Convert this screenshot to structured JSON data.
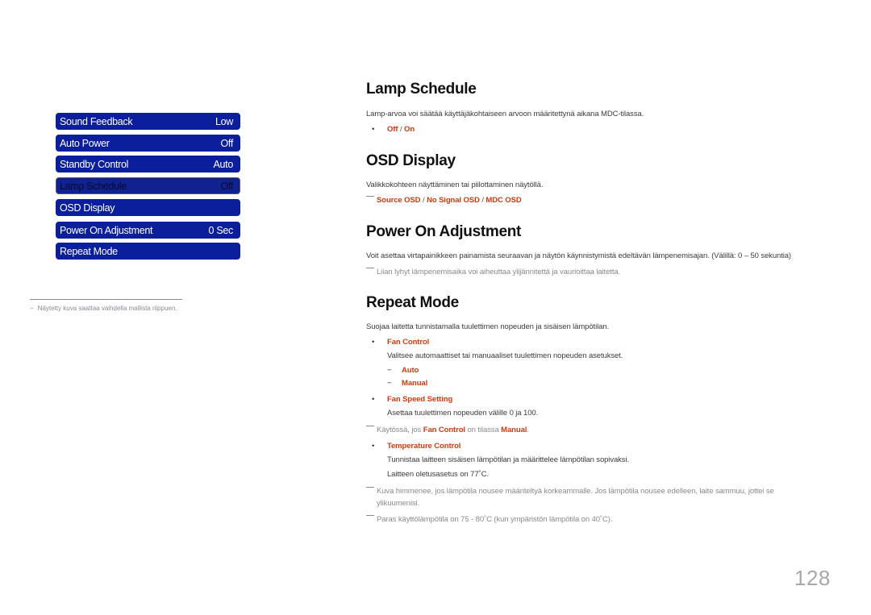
{
  "osd_menu": {
    "items": [
      {
        "label": "Sound Feedback",
        "value": "Low",
        "selected": false
      },
      {
        "label": "Auto Power",
        "value": "Off",
        "selected": false
      },
      {
        "label": "Standby Control",
        "value": "Auto",
        "selected": false
      },
      {
        "label": "Lamp Schedule",
        "value": "Off",
        "selected": true
      },
      {
        "label": "OSD Display",
        "value": "",
        "selected": false
      },
      {
        "label": "Power On Adjustment",
        "value": "0 Sec",
        "selected": false
      },
      {
        "label": "Repeat Mode",
        "value": "",
        "selected": false
      }
    ]
  },
  "footnote": {
    "dash": "−",
    "text": "Näytetty kuva saattaa vaihdella mallista riippuen."
  },
  "sections": {
    "lamp_schedule": {
      "title": "Lamp Schedule",
      "desc": "Lamp-arvoa voi säätää käyttäjäkohtaiseen arvoon määritettynä aikana MDC-tilassa.",
      "bullet": "•",
      "opt1": "Off",
      "slash": " / ",
      "opt2": "On"
    },
    "osd_display": {
      "title": "OSD Display",
      "desc": "Valikkokohteen näyttäminen tai piilottaminen näytöllä.",
      "opt1": "Source OSD",
      "opt2": "No Signal OSD",
      "opt3": "MDC OSD",
      "slash": " / "
    },
    "power_on_adjustment": {
      "title": "Power On Adjustment",
      "desc": "Voit asettaa virtapainikkeen painamista seuraavan ja näytön käynnistymistä edeltävän lämpenemisajan. (Välillä: 0 – 50 sekuntia)",
      "note": "Liian lyhyt lämpenemisaika voi aiheuttaa ylijännitettä ja vaurioittaa laitetta."
    },
    "repeat_mode": {
      "title": "Repeat Mode",
      "desc": "Suojaa laitetta tunnistamalla tuulettimen nopeuden ja sisäisen lämpötilan.",
      "bullet": "•",
      "sub_dash": "−",
      "fan_control": {
        "label": "Fan Control",
        "desc": "Valitsee automaattiset tai manuaaliset tuulettimen nopeuden asetukset.",
        "options": [
          "Auto",
          "Manual"
        ]
      },
      "fan_speed": {
        "label": "Fan Speed Setting",
        "desc": "Asettaa tuulettimen nopeuden välille 0 ja 100."
      },
      "fan_note": {
        "pre": "Käytössä, jos ",
        "term1": "Fan Control",
        "mid": " on tilassa ",
        "term2": "Manual",
        "post": "."
      },
      "temperature": {
        "label": "Temperature Control",
        "desc": "Tunnistaa laitteen sisäisen lämpötilan ja määrittelee lämpötilan sopivaksi.",
        "default": "Laitteen oletusasetus on 77˚C."
      },
      "note1a": "Kuva himmenee, jos lämpötila nousee määriteltyä korkeammalle. Jos lämpötila nousee edelleen, laite sammuu, jottei se",
      "note1b": "ylikuumenisi.",
      "note2": "Paras käyttölämpötila on 75 - 80˚C (kun ympäristön lämpötila on 40˚C)."
    }
  },
  "page_number": "128"
}
